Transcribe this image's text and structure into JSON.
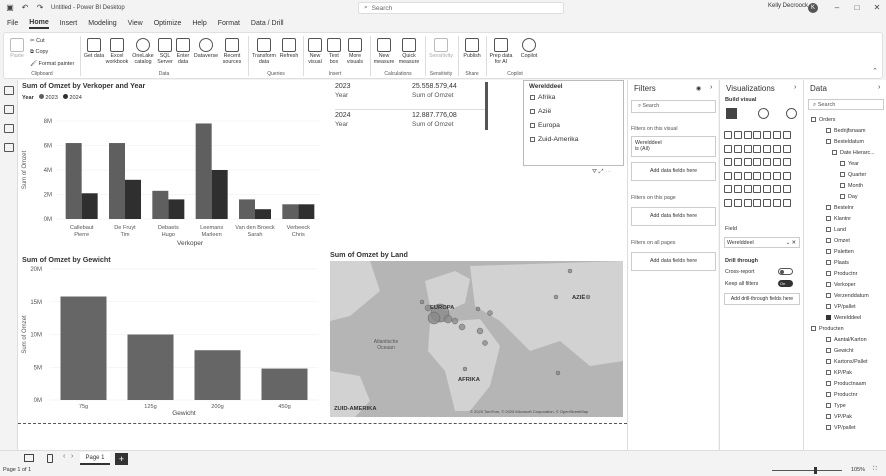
{
  "app": {
    "title": "Untitled - Power BI Desktop",
    "search_placeholder": "Search",
    "user": "Kelly Decroock",
    "user_initial": "K"
  },
  "menu": [
    "File",
    "Home",
    "Insert",
    "Modeling",
    "View",
    "Optimize",
    "Help",
    "Format",
    "Data / Drill"
  ],
  "ribbon": {
    "clipboard": {
      "paste": "Paste",
      "cut": "Cut",
      "copy": "Copy",
      "format_painter": "Format painter",
      "group": "Clipboard"
    },
    "data": {
      "items": [
        "Get data",
        "Excel workbook",
        "OneLake catalog",
        "SQL Server",
        "Enter data",
        "Dataverse",
        "Recent sources"
      ],
      "group": "Data"
    },
    "queries": {
      "items": [
        "Transform data",
        "Refresh"
      ],
      "group": "Queries"
    },
    "insert": {
      "items": [
        "New visual",
        "Text box",
        "More visuals"
      ],
      "group": "Insert"
    },
    "calculations": {
      "items": [
        "New measure",
        "Quick measure"
      ],
      "group": "Calculations"
    },
    "sensitivity": {
      "items": [
        "Sensitivity"
      ],
      "group": "Sensitivity"
    },
    "share": {
      "items": [
        "Publish"
      ],
      "group": "Share"
    },
    "copilot": {
      "items": [
        "Prep data for AI",
        "Copilot"
      ],
      "group": "Copilot"
    }
  },
  "chart1_legend": {
    "label": "Year",
    "s1": "2023",
    "s2": "2024"
  },
  "chart_data": [
    {
      "type": "bar",
      "title": "Sum of Omzet by Verkoper and Year",
      "xlabel": "Verkoper",
      "ylabel": "Sum of Omzet",
      "categories": [
        "Callebaut Pierre",
        "De Fruyt Tim",
        "Debaets Hugo",
        "Leemans Marleen",
        "Van den Broeck Sarah",
        "Verbeeck Chris"
      ],
      "yticks": [
        "0M",
        "2M",
        "4M",
        "6M",
        "8M"
      ],
      "ylim": [
        0,
        8
      ],
      "series": [
        {
          "name": "2023",
          "values": [
            6.2,
            6.2,
            2.3,
            7.8,
            1.6,
            1.2
          ]
        },
        {
          "name": "2024",
          "values": [
            2.1,
            3.2,
            1.6,
            4.0,
            0.8,
            1.2
          ]
        }
      ],
      "colors": [
        "#5f5f5f",
        "#2f2f2f"
      ]
    },
    {
      "type": "bar",
      "title": "Sum of Omzet by Gewicht",
      "xlabel": "Gewicht",
      "ylabel": "Sum of Omzet",
      "categories": [
        "75g",
        "125g",
        "200g",
        "450g"
      ],
      "yticks": [
        "0M",
        "5M",
        "10M",
        "15M",
        "20M"
      ],
      "ylim": [
        0,
        20
      ],
      "values": [
        15.8,
        10.0,
        7.6,
        4.8
      ],
      "colors": [
        "#666666"
      ]
    },
    {
      "type": "table",
      "title": "Sum of Omzet by Year",
      "rows": [
        {
          "year": "2023",
          "year_label": "Year",
          "value": "25.558.579,44",
          "value_label": "Sum of Omzet"
        },
        {
          "year": "2024",
          "year_label": "Year",
          "value": "12.887.776,08",
          "value_label": "Sum of Omzet"
        }
      ]
    }
  ],
  "slicer": {
    "title": "Werelddeel",
    "items": [
      "Afrika",
      "Azië",
      "Europa",
      "Zuid-Amerika"
    ]
  },
  "map": {
    "title": "Sum of Omzet by Land",
    "labels": {
      "europa": "EUROPA",
      "azie": "AZIË",
      "afrika": "AFRIKA",
      "zuid_amerika": "ZUID-AMERIKA",
      "ocean": "Atlantische Oceaan"
    },
    "attribution": "© 2025 TomTom, © 2025 Microsoft Corporation, © OpenStreetMap",
    "brand": "Microsoft Bing"
  },
  "filters": {
    "title": "Filters",
    "search": "Search",
    "on_visual": "Filters on this visual",
    "card_title": "Werelddeel",
    "card_sub": "is (All)",
    "add": "Add data fields here",
    "on_page": "Filters on this page",
    "on_all": "Filters on all pages"
  },
  "viz": {
    "title": "Visualizations",
    "build": "Build visual",
    "field": "Field",
    "field_value": "Werelddeel",
    "drill": "Drill through",
    "cross": "Cross-report",
    "keep": "Keep all filters",
    "keep_state": "On",
    "add_drill": "Add drill-through fields here"
  },
  "data_pane": {
    "title": "Data",
    "search": "Search",
    "orders": "Orders",
    "orders_fields": [
      "Bedrijfsnaam",
      "Besteldatum",
      "Date Hierarc...",
      "Year",
      "Quarter",
      "Month",
      "Day",
      "Bestelnr",
      "Klantnr",
      "Land",
      "Omzet",
      "Paletten",
      "Plaats",
      "Productnr",
      "Verkoper",
      "Verzenddatum",
      "VP/pallet",
      "Werelddeel"
    ],
    "producten": "Producten",
    "producten_fields": [
      "Aantal/Karton",
      "Gewicht",
      "Kartons/Pallet",
      "KP/Pak",
      "Productnaam",
      "Productnr",
      "Type",
      "VP/Pak",
      "VP/pallet"
    ]
  },
  "pages": {
    "current": "Page 1",
    "status": "Page 1 of 1",
    "zoom": "105%"
  }
}
